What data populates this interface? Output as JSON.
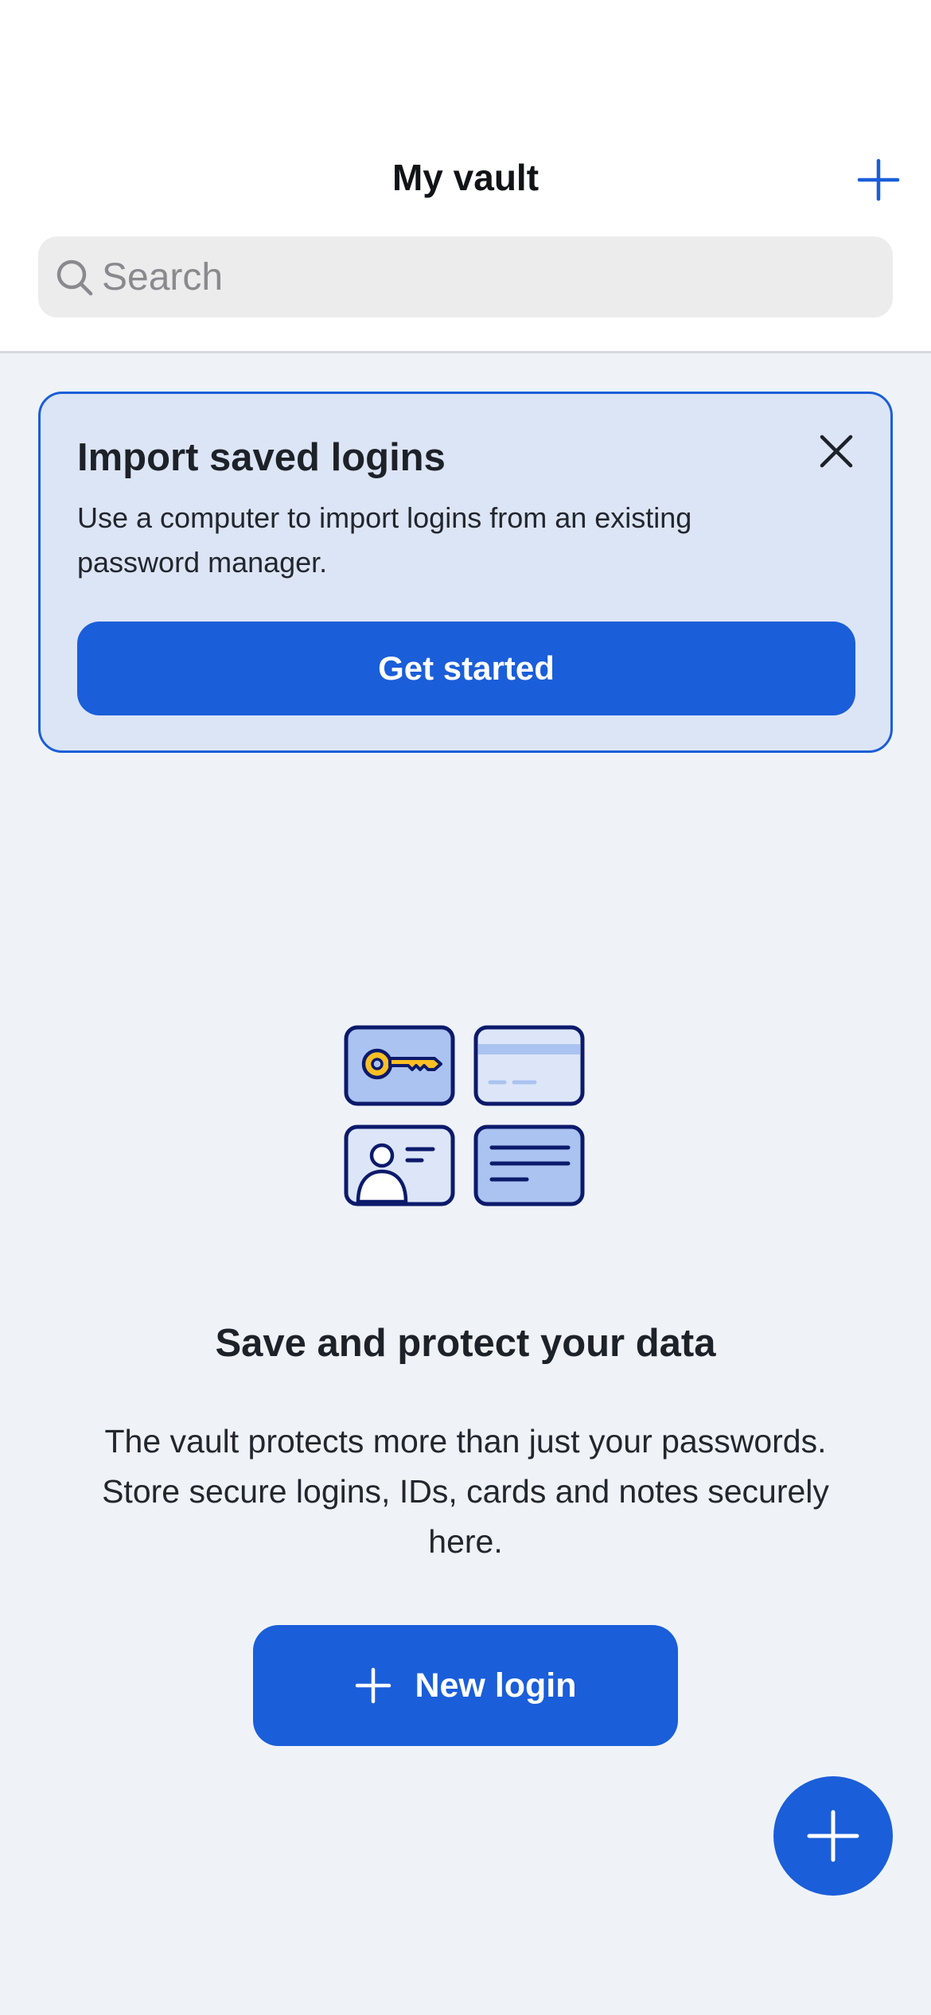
{
  "header": {
    "title": "My vault",
    "add_icon": "plus-icon"
  },
  "search": {
    "placeholder": "Search",
    "value": "",
    "icon": "search-icon"
  },
  "banner": {
    "title": "Import saved logins",
    "body": "Use a computer to import logins from an existing password manager.",
    "button_label": "Get started",
    "close_icon": "close-icon"
  },
  "empty_state": {
    "illustration": "vault-items-illustration",
    "title": "Save and protect your data",
    "body": "The vault protects more than just your passwords. Store secure logins, IDs, cards and notes securely here.",
    "button_label": "New login",
    "button_icon": "plus-icon"
  },
  "fab": {
    "icon": "plus-icon"
  },
  "colors": {
    "accent": "#1a5ed9",
    "background": "#eff3f8",
    "banner_background": "#dce5f5",
    "illustration_navy": "#0c1a6b",
    "illustration_yellow": "#fbbf24",
    "illustration_light_blue": "#aac3f0"
  }
}
